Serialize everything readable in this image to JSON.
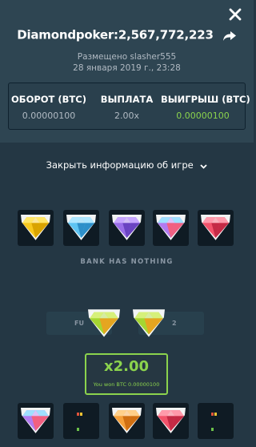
{
  "header": {
    "close_icon": "close-icon",
    "share_icon": "share-icon",
    "title": "Diamondpoker:2,567,772,223",
    "posted_by": "Размещено slasher555",
    "date": "28 января 2019 г., 23:28"
  },
  "stats": {
    "turnover_label": "ОБОРОТ (BTC)",
    "turnover_value": "0.00000100",
    "payout_label": "ВЫПЛАТА",
    "payout_value": "2.00x",
    "profit_label": "ВЫИГРЫШ (BTC)",
    "profit_value": "0.00000100"
  },
  "toggle": {
    "label": "Закрыть информацию об игре",
    "icon": "chevron-down-icon"
  },
  "bank": {
    "gems": [
      "yellow",
      "blue",
      "purple",
      "rainbow",
      "red"
    ],
    "status": "BANK HAS NOTHING"
  },
  "hands": {
    "left_label": "FU",
    "right_label": "2",
    "gems": [
      "green",
      "green"
    ]
  },
  "result": {
    "multiplier": "x2.00",
    "won_text": "You won BTC 0.00000100"
  },
  "player": {
    "slots": [
      "rainbow",
      "empty",
      "orange",
      "red",
      "empty"
    ]
  },
  "colors": {
    "accent_green": "#8bd34d",
    "panel_bg": "#2e4552",
    "page_bg": "#243744",
    "slot_bg": "#0f1b24"
  }
}
